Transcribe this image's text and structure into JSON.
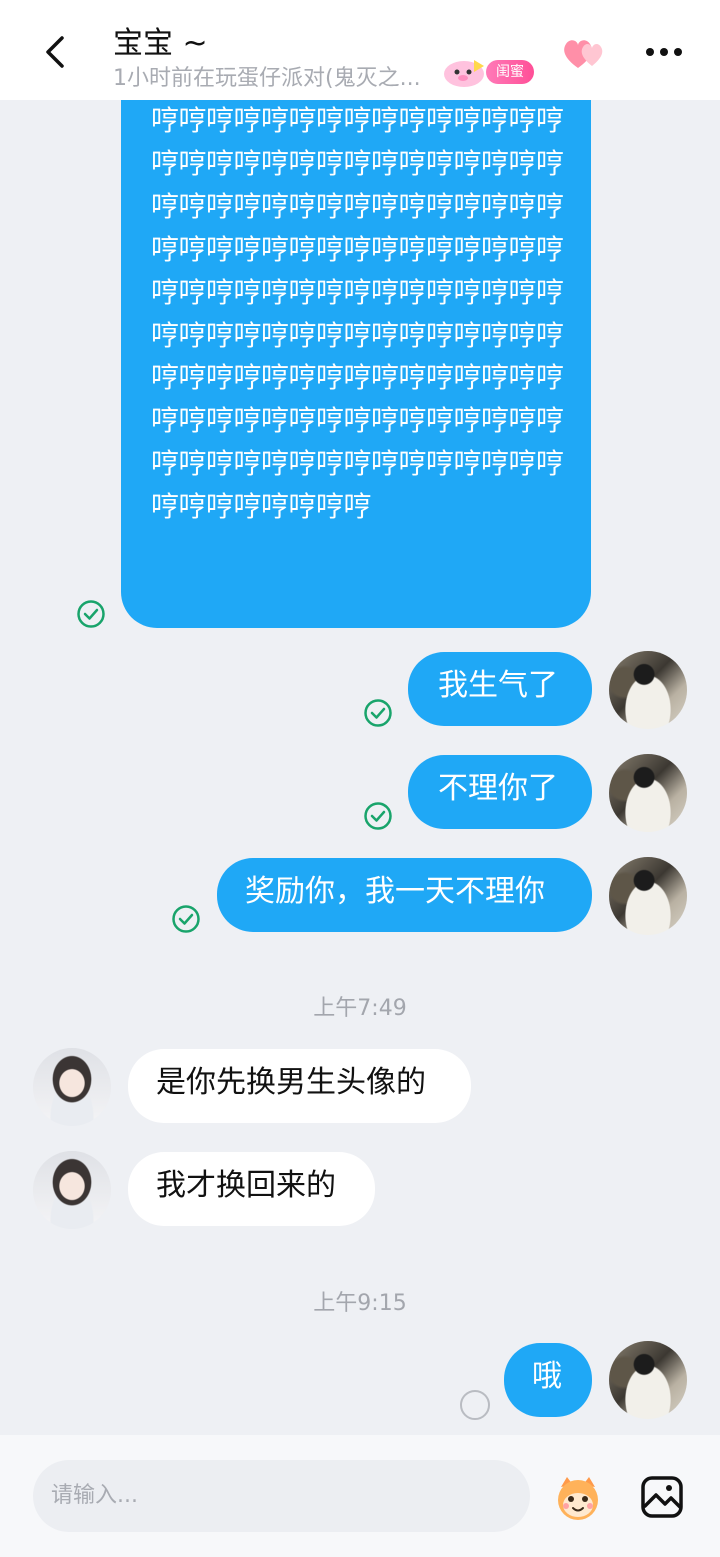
{
  "header": {
    "title": "宝宝 ~",
    "status": "1小时前在玩蛋仔派对(鬼灭之...",
    "relation_badge": "闺蜜"
  },
  "messages": {
    "hum_block": "哼哼哼哼哼哼哼哼哼哼哼哼哼哼哼哼哼哼哼哼哼哼哼哼哼哼哼哼哼哼哼哼哼哼哼哼哼哼哼哼哼哼哼哼哼哼哼哼哼哼哼哼哼哼哼哼哼哼哼哼哼哼哼哼哼哼哼哼哼哼哼哼哼哼哼哼哼哼哼哼哼哼哼哼哼哼哼哼哼哼哼哼哼哼哼哼哼哼哼哼哼哼哼哼哼哼哼哼哼哼哼哼哼哼哼哼哼哼哼哼哼哼哼哼哼哼哼哼哼哼哼哼哼哼哼哼哼哼哼哼哼哼哼",
    "m1": "我生气了",
    "m2": "不理你了",
    "m3": "奖励你，我一天不理你",
    "time1": "上午7:49",
    "r1": "是你先换男生头像的",
    "r2": "我才换回来的",
    "time2": "上午9:15",
    "m4": "哦"
  },
  "input": {
    "placeholder": "请输入..."
  },
  "colors": {
    "outgoing_bubble": "#1fa8f6",
    "incoming_bubble": "#ffffff",
    "read_check": "#19a46b",
    "background": "#eef0f4"
  }
}
